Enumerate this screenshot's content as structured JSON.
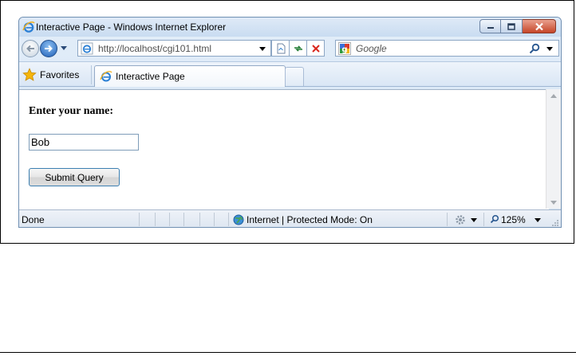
{
  "window": {
    "title": "Interactive Page - Windows Internet Explorer"
  },
  "address_bar": {
    "url": "http://localhost/cgi101.html"
  },
  "search": {
    "placeholder": "Google"
  },
  "favorites": {
    "label": "Favorites"
  },
  "tab": {
    "label": "Interactive Page"
  },
  "page": {
    "prompt": "Enter your name:",
    "name_value": "Bob",
    "submit_label": "Submit Query"
  },
  "status": {
    "text": "Done",
    "zone": "Internet | Protected Mode: On",
    "zoom": "125%"
  },
  "icons": {
    "browser": "ie-logo-icon",
    "back": "back-arrow-icon",
    "forward": "forward-arrow-icon",
    "compat": "compatibility-view-icon",
    "refresh": "refresh-icon",
    "stop": "stop-icon",
    "search": "magnifier-icon",
    "favorites": "star-icon",
    "zone": "globe-icon",
    "addons": "gear-icon",
    "zoom": "zoom-icon"
  },
  "colors": {
    "accent": "#1d5db6",
    "close": "#c64628",
    "stop": "#d9261c",
    "star": "#f5b60b"
  }
}
